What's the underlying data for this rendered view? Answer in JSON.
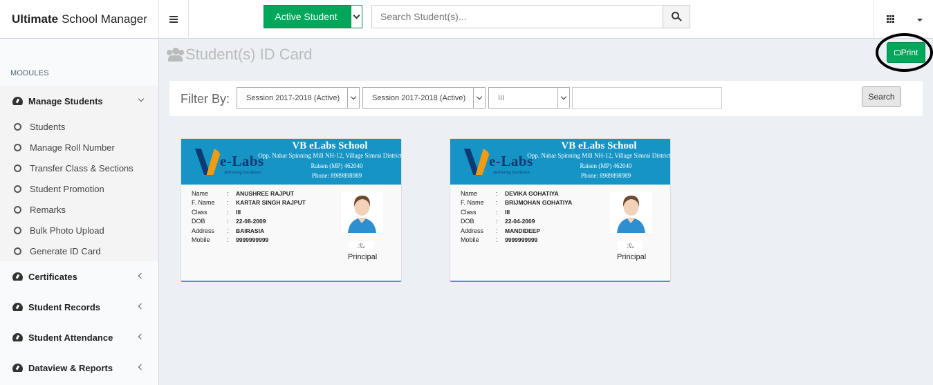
{
  "header": {
    "brand_bold": "Ultimate",
    "brand_rest": "School Manager",
    "student_filter": "Active Student",
    "search_placeholder": "Search Student(s)..."
  },
  "sidebar": {
    "section_label": "MODULES",
    "menus": [
      {
        "label": "Manage Students",
        "expanded": true
      },
      {
        "label": "Certificates",
        "expanded": false
      },
      {
        "label": "Student Records",
        "expanded": false
      },
      {
        "label": "Student Attendance",
        "expanded": false
      },
      {
        "label": "Dataview & Reports",
        "expanded": false
      }
    ],
    "submenu": [
      "Students",
      "Manage Roll Number",
      "Transfer Class & Sections",
      "Student Promotion",
      "Remarks",
      "Bulk Photo Upload",
      "Generate ID Card"
    ]
  },
  "page": {
    "title": "Student(s) ID Card",
    "print_label": "Print"
  },
  "filter": {
    "label": "Filter By:",
    "session_from": "Session 2017-2018 (Active)",
    "session_to": "Session 2017-2018 (Active)",
    "class": "III",
    "text_value": "",
    "search_label": "Search"
  },
  "school": {
    "name": "VB eLabs School",
    "address_line1": "Opp. Nahar Spinning Mill NH-12, Village Simrai District",
    "address_line2": "Raisen (MP) 462040",
    "phone": "Phone: 8989898989",
    "logo_text": "e-Labs",
    "logo_tagline": "Delivering Excellence"
  },
  "card_labels": {
    "name": "Name",
    "fname": "F. Name",
    "class": "Class",
    "dob": "DOB",
    "address": "Address",
    "mobile": "Mobile",
    "sep": ":",
    "principal": "Principal"
  },
  "cards": [
    {
      "name": "ANUSHREE RAJPUT",
      "fname": "KARTAR SINGH RAJPUT",
      "class": "III",
      "dob": "22-08-2009",
      "address": "BAIRASIA",
      "mobile": "9999999999"
    },
    {
      "name": "DEVIKA GOHATIYA",
      "fname": "BRIJMOHAN GOHATIYA",
      "class": "III",
      "dob": "22-04-2009",
      "address": "MANDIDEEP",
      "mobile": "9999999999"
    }
  ],
  "colors": {
    "accent_green": "#00a65a",
    "card_header": "#1594c5"
  }
}
